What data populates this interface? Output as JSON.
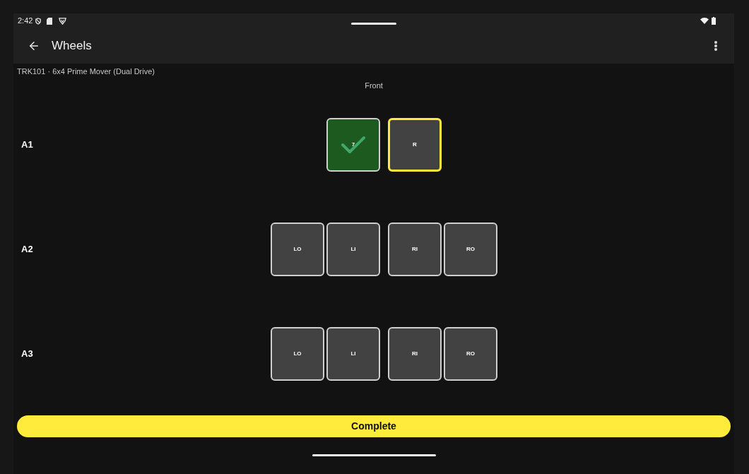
{
  "status_bar": {
    "time": "2:42"
  },
  "app_bar": {
    "title": "Wheels"
  },
  "vehicle": "TRK101 · 6x4 Prime Mover (Dual Drive)",
  "direction_label": "Front",
  "axles": [
    {
      "label": "A1",
      "left": [
        {
          "label": "7",
          "checked": true,
          "selected": false
        }
      ],
      "right": [
        {
          "label": "R",
          "checked": false,
          "selected": true
        }
      ]
    },
    {
      "label": "A2",
      "left": [
        {
          "label": "LO",
          "checked": false,
          "selected": false
        },
        {
          "label": "LI",
          "checked": false,
          "selected": false
        }
      ],
      "right": [
        {
          "label": "RI",
          "checked": false,
          "selected": false
        },
        {
          "label": "RO",
          "checked": false,
          "selected": false
        }
      ]
    },
    {
      "label": "A3",
      "left": [
        {
          "label": "LO",
          "checked": false,
          "selected": false
        },
        {
          "label": "LI",
          "checked": false,
          "selected": false
        }
      ],
      "right": [
        {
          "label": "RI",
          "checked": false,
          "selected": false
        },
        {
          "label": "RO",
          "checked": false,
          "selected": false
        }
      ]
    }
  ],
  "complete_button": {
    "label": "Complete"
  }
}
